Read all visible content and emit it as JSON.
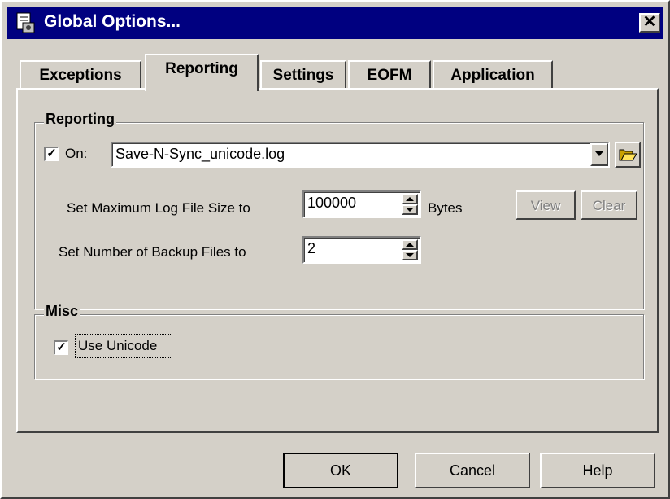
{
  "window": {
    "title": "Global Options...",
    "close_label": "✕"
  },
  "tabs": [
    {
      "label": "Exceptions"
    },
    {
      "label": "Reporting"
    },
    {
      "label": "Settings"
    },
    {
      "label": "EOFM"
    },
    {
      "label": "Application"
    }
  ],
  "reporting": {
    "group_label": "Reporting",
    "on_checked": true,
    "on_label": "On:",
    "log_file": "Save-N-Sync_unicode.log",
    "max_size_label": "Set Maximum Log File Size to",
    "max_size_value": "100000",
    "bytes_label": "Bytes",
    "backup_label": "Set Number of Backup Files to",
    "backup_value": "2",
    "view_label": "View",
    "clear_label": "Clear"
  },
  "misc": {
    "group_label": "Misc",
    "unicode_checked": true,
    "unicode_label": "Use Unicode"
  },
  "footer": {
    "ok_label": "OK",
    "cancel_label": "Cancel",
    "help_label": "Help"
  },
  "icons": {
    "title": "options-icon",
    "browse": "folder-open-icon"
  },
  "colors": {
    "titlebar": "#000080",
    "face": "#d4d0c8"
  }
}
